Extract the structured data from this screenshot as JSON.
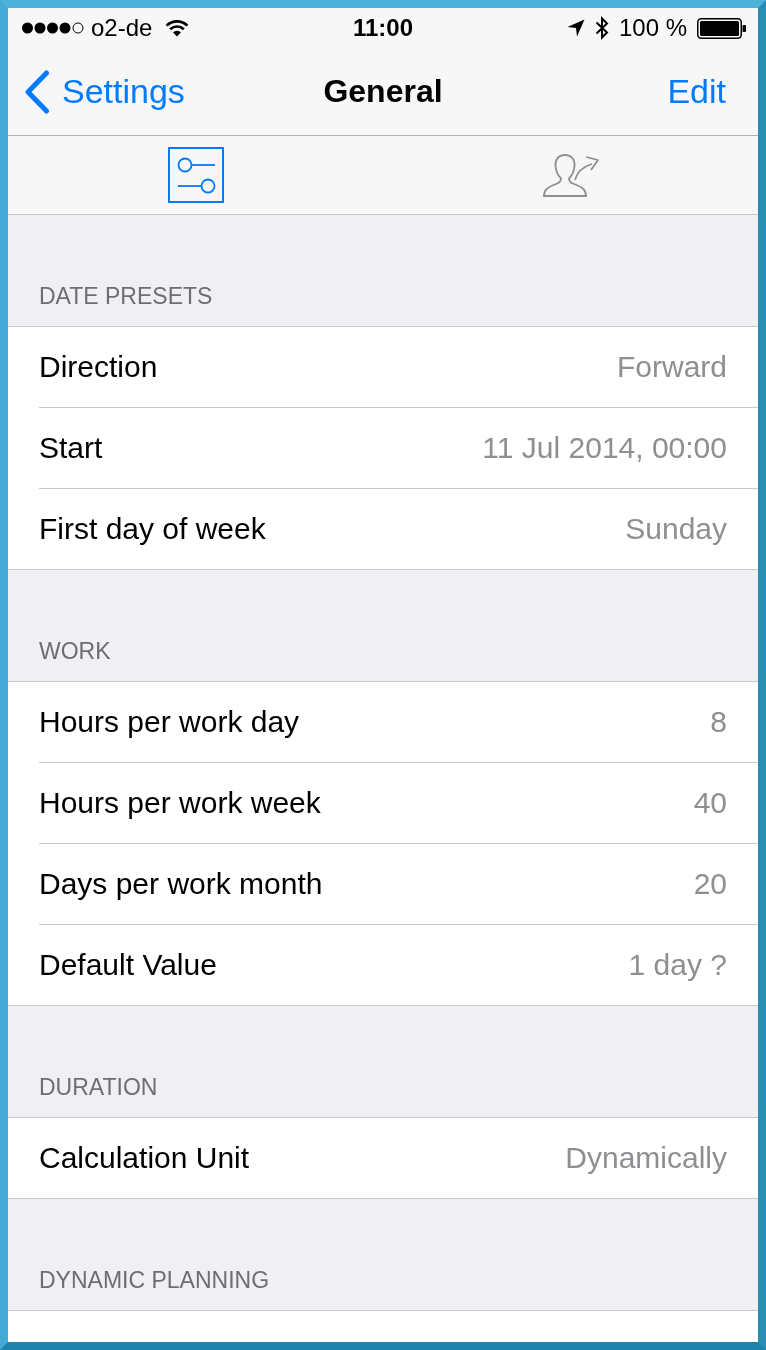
{
  "status_bar": {
    "carrier": "o2-de",
    "time": "11:00",
    "battery": "100 %"
  },
  "nav_bar": {
    "back": "Settings",
    "title": "General",
    "action": "Edit"
  },
  "segments": [
    {
      "kind": "sliders",
      "selected": true
    },
    {
      "kind": "contact-share",
      "selected": false
    }
  ],
  "sections": [
    {
      "header": "DATE PRESETS",
      "rows": [
        {
          "label": "Direction",
          "value": "Forward"
        },
        {
          "label": "Start",
          "value": "11 Jul 2014, 00:00"
        },
        {
          "label": "First day of week",
          "value": "Sunday"
        }
      ]
    },
    {
      "header": "WORK",
      "rows": [
        {
          "label": "Hours per work day",
          "value": "8"
        },
        {
          "label": "Hours per work week",
          "value": "40"
        },
        {
          "label": "Days per work month",
          "value": "20"
        },
        {
          "label": "Default Value",
          "value": "1 day ?"
        }
      ]
    },
    {
      "header": "DURATION",
      "rows": [
        {
          "label": "Calculation Unit",
          "value": "Dynamically"
        }
      ]
    },
    {
      "header": "DYNAMIC PLANNING"
    }
  ]
}
